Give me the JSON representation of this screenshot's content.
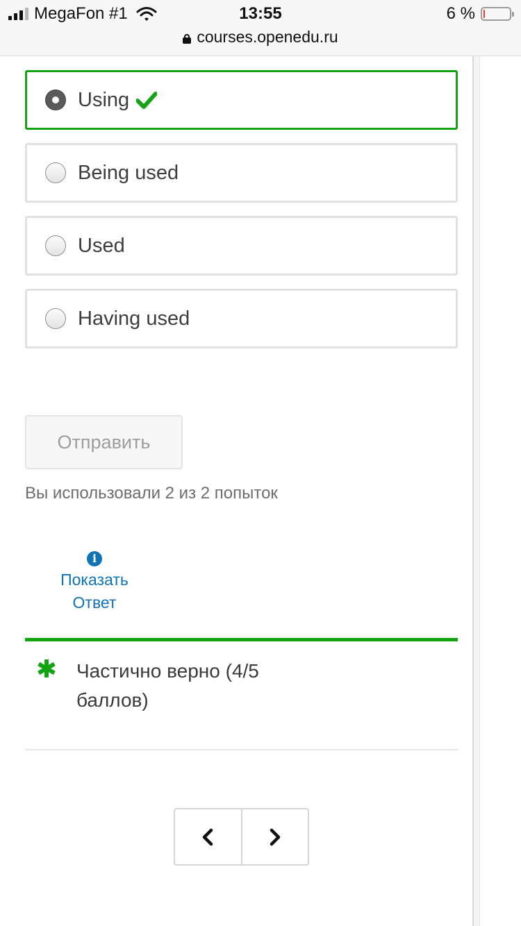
{
  "status_bar": {
    "carrier": "MegaFon #1",
    "time": "13:55",
    "battery_percent_text": "6 %",
    "battery_level": 0.06,
    "battery_color": "#e8392f",
    "url": "courses.openedu.ru"
  },
  "question": {
    "options": [
      {
        "label": "Using",
        "selected": true,
        "correct": true
      },
      {
        "label": "Being used",
        "selected": false
      },
      {
        "label": "Used",
        "selected": false
      },
      {
        "label": "Having used",
        "selected": false
      }
    ]
  },
  "actions": {
    "submit_label": "Отправить",
    "attempts_text": "Вы использовали 2 из 2 попыток",
    "show_answer_line1": "Показать",
    "show_answer_line2": "Ответ"
  },
  "result": {
    "text": "Частично верно (4/5 баллов)",
    "color": "#11a311"
  },
  "pager": {
    "prev_icon": "chevron-left-icon",
    "next_icon": "chevron-right-icon"
  },
  "colors": {
    "correct_green": "#16a316",
    "link_blue": "#0f73b6"
  }
}
